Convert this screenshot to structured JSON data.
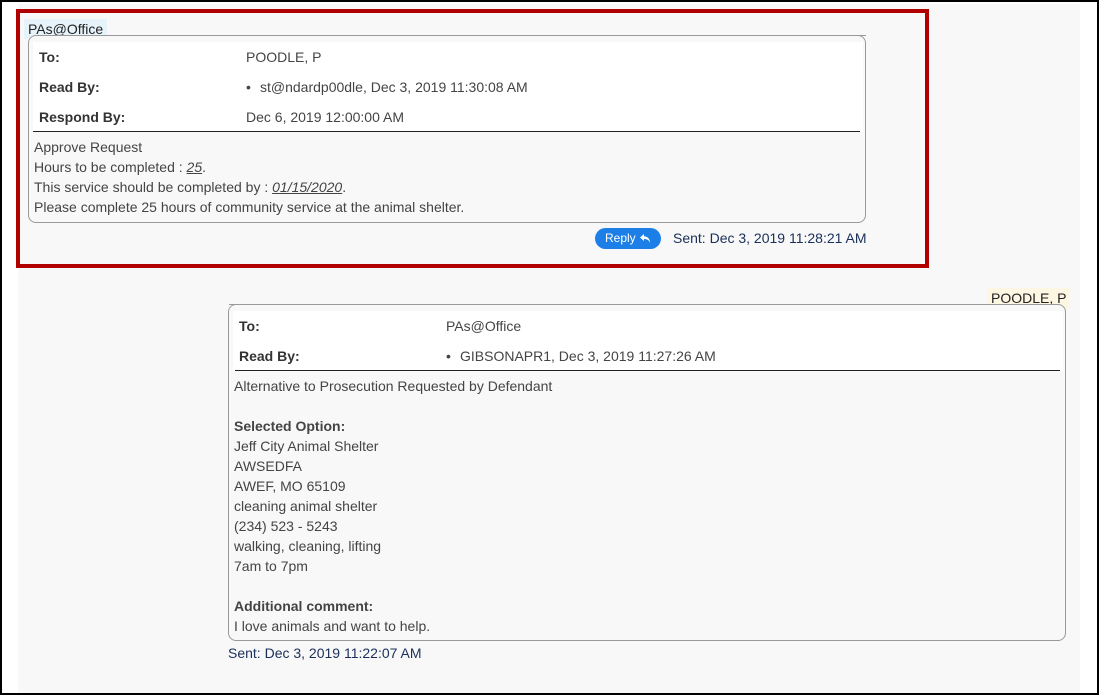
{
  "message1": {
    "sender": "PAs@Office",
    "headers": {
      "to_label": "To:",
      "to_value": "POODLE, P",
      "read_by_label": "Read By:",
      "read_by_value": "st@ndardp00dle, Dec 3, 2019 11:30:08 AM",
      "respond_by_label": "Respond By:",
      "respond_by_value": "Dec 6, 2019 12:00:00 AM"
    },
    "body": {
      "line1": "Approve Request",
      "hours_prefix": "Hours to be completed : ",
      "hours_value": "25",
      "completed_prefix": "This service should be completed by : ",
      "completed_value": "01/15/2020",
      "line4": "Please complete 25 hours of community service at the animal shelter."
    },
    "reply_label": "Reply",
    "sent": "Sent: Dec 3, 2019 11:28:21 AM"
  },
  "message2": {
    "sender": "POODLE, P",
    "headers": {
      "to_label": "To:",
      "to_value": "PAs@Office",
      "read_by_label": "Read By:",
      "read_by_value": "GIBSONAPR1, Dec 3, 2019 11:27:26 AM"
    },
    "body": {
      "line1": "Alternative to Prosecution Requested by Defendant",
      "selected_label": "Selected Option:",
      "option_lines": [
        "Jeff City Animal Shelter",
        "AWSEDFA",
        "AWEF, MO 65109",
        "cleaning animal shelter",
        "(234) 523 - 5243",
        "walking, cleaning, lifting",
        "7am to 7pm"
      ],
      "comment_label": "Additional comment:",
      "comment": "I love animals and want to help."
    },
    "sent": "Sent: Dec 3, 2019 11:22:07 AM"
  }
}
